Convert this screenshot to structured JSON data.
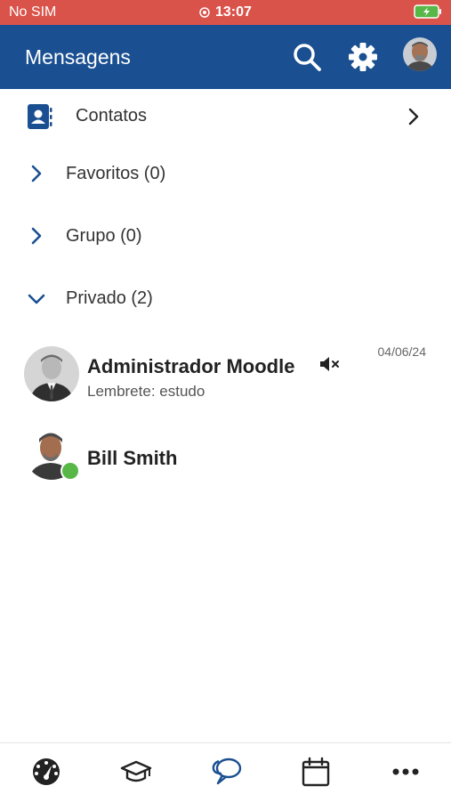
{
  "status_bar": {
    "carrier": "No SIM",
    "time": "13:07",
    "battery_icon": "battery-charging-icon"
  },
  "header": {
    "title": "Mensagens",
    "search_icon": "search-icon",
    "settings_icon": "gear-icon",
    "avatar_icon": "user-avatar"
  },
  "contacts": {
    "label": "Contatos",
    "icon": "address-book-icon"
  },
  "sections": [
    {
      "label": "Favoritos (0)",
      "expanded": false
    },
    {
      "label": "Grupo (0)",
      "expanded": false
    },
    {
      "label": "Privado (2)",
      "expanded": true
    }
  ],
  "conversations": [
    {
      "name": "Administrador Moodle",
      "preview": "Lembrete: estudo",
      "date": "04/06/24",
      "muted": true,
      "online": false
    },
    {
      "name": "Bill Smith",
      "preview": "",
      "date": "",
      "muted": false,
      "online": true
    }
  ],
  "tabbar": {
    "items": [
      "dashboard-icon",
      "courses-icon",
      "messages-icon",
      "calendar-icon",
      "more-icon"
    ],
    "active_index": 2
  },
  "colors": {
    "status_bar": "#d9534a",
    "header": "#1a4f91",
    "accent": "#1a4f91",
    "online": "#57b847"
  }
}
